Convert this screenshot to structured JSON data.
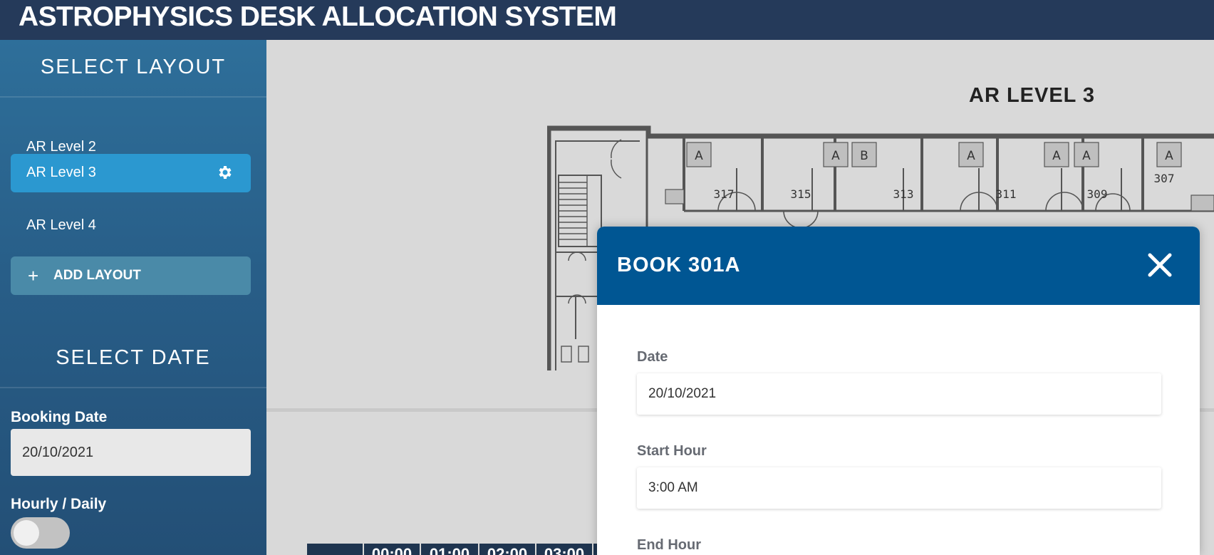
{
  "app": {
    "title": "ASTROPHYSICS DESK ALLOCATION SYSTEM"
  },
  "sidebar": {
    "layout_heading": "SELECT LAYOUT",
    "layouts": [
      {
        "label": "AR Level 2",
        "active": false
      },
      {
        "label": "AR Level 3",
        "active": true
      },
      {
        "label": "AR Level 4",
        "active": false
      }
    ],
    "add_layout_label": "ADD LAYOUT",
    "date_heading": "SELECT DATE",
    "booking_date_label": "Booking Date",
    "booking_date_value": "20/10/2021",
    "hourly_daily_label": "Hourly / Daily",
    "hourly_daily_on": false
  },
  "main": {
    "layout_title": "AR LEVEL 3",
    "floorplan": {
      "rooms": [
        "317",
        "315",
        "313",
        "311",
        "309",
        "307"
      ],
      "desk_labels": [
        "A",
        "A",
        "B",
        "A",
        "A",
        "A",
        "A"
      ]
    },
    "timeline": {
      "hours": [
        "",
        "00:00",
        "01:00",
        "02:00",
        "03:00",
        ""
      ]
    }
  },
  "modal": {
    "title": "BOOK 301A",
    "date_label": "Date",
    "date_value": "20/10/2021",
    "start_label": "Start Hour",
    "start_value": "3:00 AM",
    "end_label": "End Hour"
  },
  "icons": {
    "gear": "gear-icon",
    "plus": "plus-icon",
    "close": "close-icon"
  },
  "colors": {
    "header": "#253a5a",
    "sidebar": "#285e88",
    "active_item": "#2b98d0",
    "modal_header": "#005693"
  }
}
